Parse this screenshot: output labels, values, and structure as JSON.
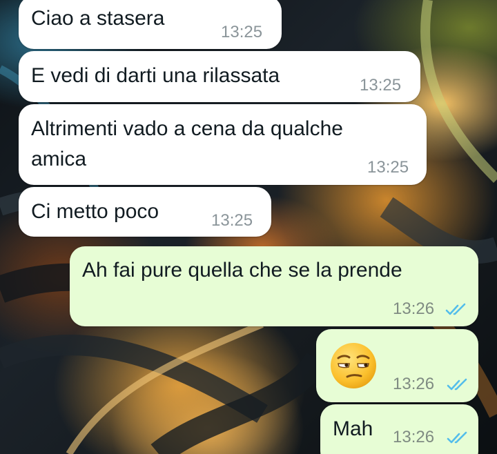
{
  "colors": {
    "incoming_bubble": "#ffffff",
    "outgoing_bubble": "#e7fdd5",
    "text": "#111b21",
    "timestamp": "#8a9499",
    "read_ticks": "#53bdeb"
  },
  "messages": [
    {
      "direction": "incoming",
      "text": "Ciao a stasera",
      "time": "13:25"
    },
    {
      "direction": "incoming",
      "text": "E vedi di darti una rilassata",
      "time": "13:25"
    },
    {
      "direction": "incoming",
      "text_line1": "Altrimenti vado a cena da qualche",
      "text_line2": "amica",
      "time": "13:25"
    },
    {
      "direction": "incoming",
      "text": "Ci metto poco",
      "time": "13:25"
    },
    {
      "direction": "outgoing",
      "text": "Ah fai pure quella che se la prende",
      "time": "13:26",
      "status_icon": "double-check-read-icon"
    },
    {
      "direction": "outgoing",
      "emoji": "unamused-face-emoji",
      "time": "13:26",
      "status_icon": "double-check-read-icon"
    },
    {
      "direction": "outgoing",
      "text": "Mah",
      "time": "13:26",
      "status_icon": "double-check-read-icon"
    }
  ]
}
